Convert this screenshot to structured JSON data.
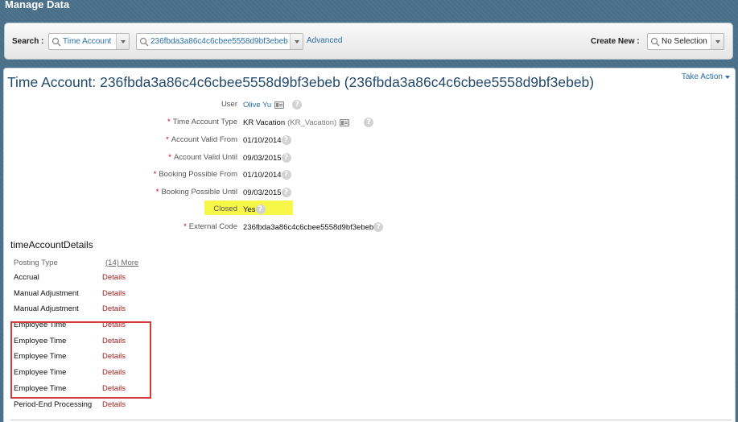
{
  "header": {
    "title": "Manage Data"
  },
  "search": {
    "label": "Search :",
    "type_value": "Time Account",
    "id_value": "236fbda3a86c4c6cbee5558d9bf3ebeb",
    "advanced": "Advanced",
    "create_label": "Create New :",
    "create_value": "No Selection"
  },
  "record": {
    "title": "Time Account: 236fbda3a86c4c6cbee5558d9bf3ebeb (236fbda3a86c4c6cbee5558d9bf3ebeb)",
    "take_action": "Take Action",
    "fields": {
      "user": {
        "label": "User",
        "value": "Olive Yu"
      },
      "type": {
        "label": "Time Account Type",
        "value": "KR Vacation",
        "code": "(KR_Vacation)"
      },
      "valid_from": {
        "label": "Account Valid From",
        "value": "01/10/2014"
      },
      "valid_until": {
        "label": "Account Valid Until",
        "value": "09/03/2015"
      },
      "booking_from": {
        "label": "Booking Possible From",
        "value": "01/10/2014"
      },
      "booking_until": {
        "label": "Booking Possible Until",
        "value": "09/03/2015"
      },
      "closed": {
        "label": "Closed",
        "value": "Yes"
      },
      "external_code": {
        "label": "External Code",
        "value": "236fbda3a86c4c6cbee5558d9bf3ebeb"
      }
    }
  },
  "details": {
    "section_title": "timeAccountDetails",
    "column_header": "Posting Type",
    "more_link": "(14) More",
    "rows": [
      {
        "type": "Accrual",
        "link": "Details"
      },
      {
        "type": "Manual Adjustment",
        "link": "Details"
      },
      {
        "type": "Manual Adjustment",
        "link": "Details"
      },
      {
        "type": "Employee Time",
        "link": "Details"
      },
      {
        "type": "Employee Time",
        "link": "Details"
      },
      {
        "type": "Employee Time",
        "link": "Details"
      },
      {
        "type": "Employee Time",
        "link": "Details"
      },
      {
        "type": "Employee Time",
        "link": "Details"
      },
      {
        "type": "Period-End Processing",
        "link": "Details"
      }
    ]
  },
  "colors": {
    "highlight": "#f7f74a",
    "annotation_box": "#d33a3a",
    "link": "#2a6fa8",
    "details_link": "#9b1c1c"
  },
  "icons": {
    "search": "magnifier-icon",
    "help": "question-icon",
    "card": "person-card-icon",
    "dropdown": "triangle-down-icon"
  }
}
